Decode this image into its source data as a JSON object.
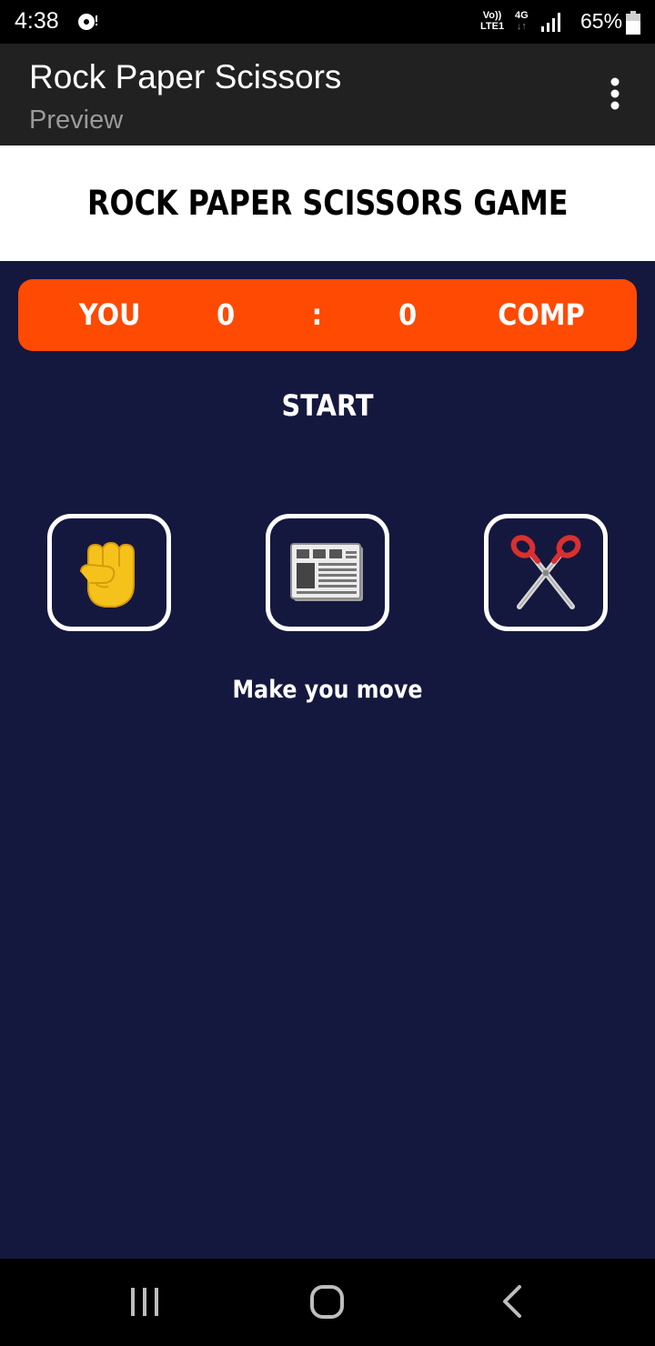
{
  "status_bar": {
    "time": "4:38",
    "volte_top": "Vo))",
    "volte_bottom": "LTE1",
    "network_top": "4G",
    "network_bottom": "↓↑",
    "battery": "65%"
  },
  "app_bar": {
    "title": "Rock Paper Scissors",
    "subtitle": "Preview"
  },
  "game": {
    "title": "ROCK PAPER SCISSORS GAME",
    "scoreboard": {
      "you_label": "YOU",
      "you_score": "0",
      "separator": ":",
      "comp_score": "0",
      "comp_label": "COMP"
    },
    "status": "START",
    "choices": [
      {
        "name": "rock",
        "icon": "raised-fist-icon"
      },
      {
        "name": "paper",
        "icon": "newspaper-icon"
      },
      {
        "name": "scissors",
        "icon": "scissors-icon"
      }
    ],
    "prompt": "Make you move"
  },
  "colors": {
    "app_bar": "#212121",
    "game_bg": "#15183e",
    "scoreboard": "#ff4a03",
    "accent_white": "#ffffff"
  }
}
